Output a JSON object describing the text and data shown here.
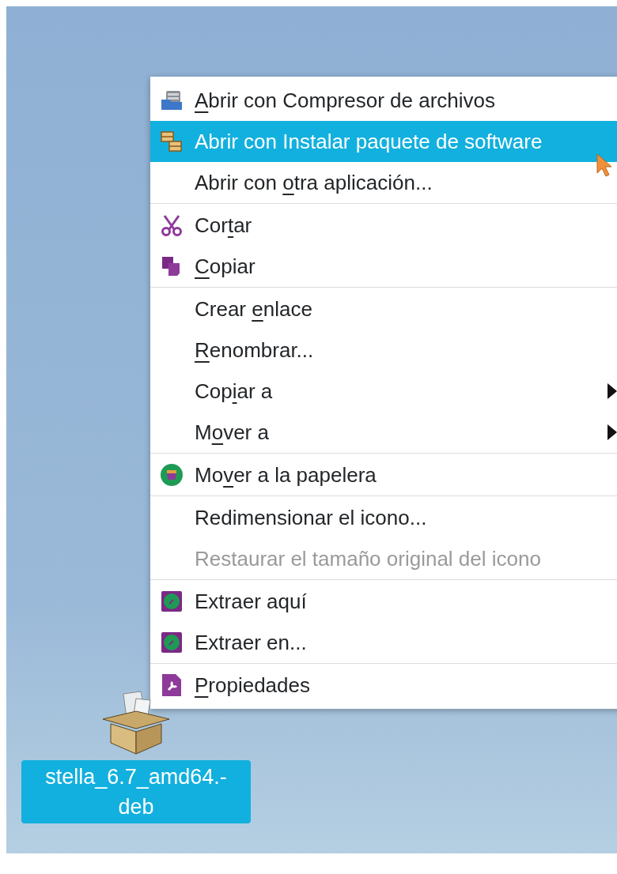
{
  "menu": {
    "groups": [
      {
        "items": [
          {
            "kind": "compressor",
            "access_key": "A",
            "text_after": "brir con Compresor de archivos",
            "selected": false,
            "disabled": false
          },
          {
            "kind": "installer",
            "label": "Abrir con Instalar paquete de software",
            "selected": true,
            "disabled": false
          },
          {
            "kind": "plain",
            "text_before": "Abrir con ",
            "access_key": "o",
            "text_after": "tra aplicación...",
            "selected": false,
            "disabled": false
          }
        ]
      },
      {
        "items": [
          {
            "kind": "cut",
            "text_before": "Cor",
            "access_key": "t",
            "text_after": "ar",
            "selected": false,
            "disabled": false
          },
          {
            "kind": "copy",
            "access_key": "C",
            "text_after": "opiar",
            "selected": false,
            "disabled": false
          }
        ]
      },
      {
        "items": [
          {
            "kind": "plain",
            "text_before": "Crear ",
            "access_key": "e",
            "text_after": "nlace",
            "selected": false,
            "disabled": false
          },
          {
            "kind": "plain",
            "access_key": "R",
            "text_after": "enombrar...",
            "selected": false,
            "disabled": false
          },
          {
            "kind": "submenu",
            "text_before": "Cop",
            "access_key": "i",
            "text_after": "ar a",
            "selected": false,
            "disabled": false
          },
          {
            "kind": "submenu",
            "text_before": "M",
            "access_key": "o",
            "text_after": "ver a",
            "selected": false,
            "disabled": false
          }
        ]
      },
      {
        "items": [
          {
            "kind": "trash",
            "text_before": "Mo",
            "access_key": "v",
            "text_after": "er a la papelera",
            "selected": false,
            "disabled": false
          }
        ]
      },
      {
        "items": [
          {
            "kind": "plain",
            "label": "Redimensionar el icono...",
            "selected": false,
            "disabled": false
          },
          {
            "kind": "plain",
            "label": "Restaurar el tamaño original del icono",
            "selected": false,
            "disabled": true
          }
        ]
      },
      {
        "items": [
          {
            "kind": "extract",
            "label": "Extraer aquí",
            "selected": false,
            "disabled": false
          },
          {
            "kind": "extract",
            "label": "Extraer en...",
            "selected": false,
            "disabled": false
          }
        ]
      },
      {
        "items": [
          {
            "kind": "properties",
            "access_key": "P",
            "text_after": "ropiedades",
            "selected": false,
            "disabled": false
          }
        ]
      }
    ]
  },
  "desktop_icon": {
    "label": "stella_6.7_amd64.-\ndeb",
    "selected": true
  }
}
